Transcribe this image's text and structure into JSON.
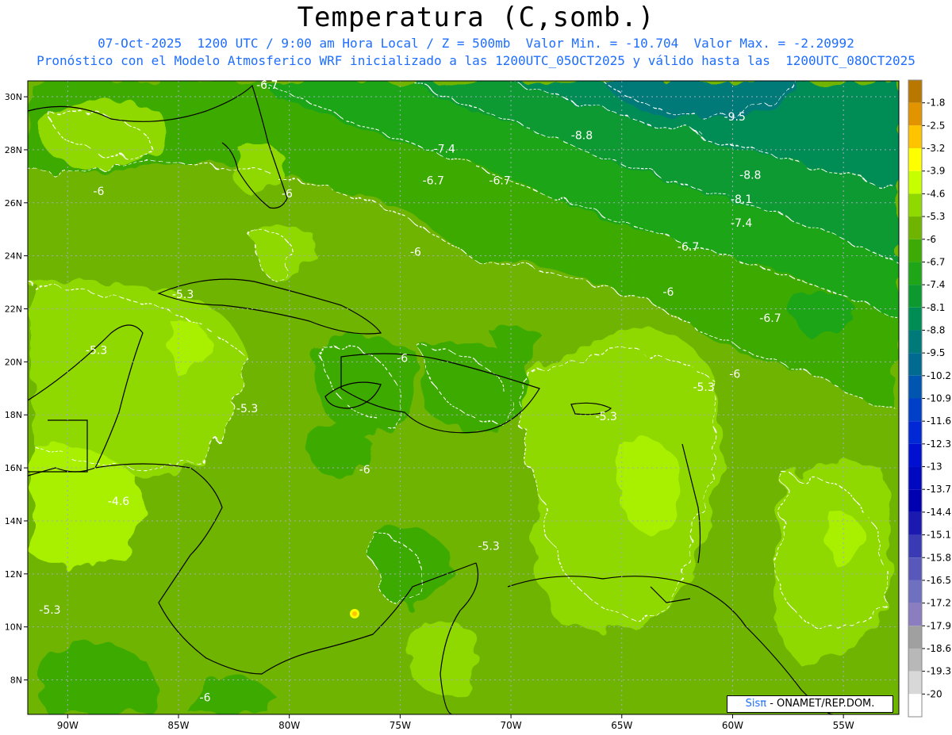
{
  "title": "Temperatura (C,somb.)",
  "subtitle_line1": "07-Oct-2025  1200 UTC / 9:00 am Hora Local / Z = 500mb  Valor Min. = -10.704  Valor Max. = -2.20992",
  "subtitle_line2": "Pronóstico con el Modelo Atmosferico WRF inicializado a las 1200UTC_05OCT2025 y válido hasta las  1200UTC_08OCT2025",
  "credit": {
    "logo": "Sisπ",
    "text": " - ONAMET/REP.DOM."
  },
  "chart_data": {
    "type": "heatmap",
    "x_ticks": [
      {
        "lon": -90,
        "label": "90W"
      },
      {
        "lon": -85,
        "label": "85W"
      },
      {
        "lon": -80,
        "label": "80W"
      },
      {
        "lon": -75,
        "label": "75W"
      },
      {
        "lon": -70,
        "label": "70W"
      },
      {
        "lon": -65,
        "label": "65W"
      },
      {
        "lon": -60,
        "label": "60W"
      },
      {
        "lon": -55,
        "label": "55W"
      }
    ],
    "y_ticks": [
      {
        "lat": 30,
        "label": "30N"
      },
      {
        "lat": 28,
        "label": "28N"
      },
      {
        "lat": 26,
        "label": "26N"
      },
      {
        "lat": 24,
        "label": "24N"
      },
      {
        "lat": 22,
        "label": "22N"
      },
      {
        "lat": 20,
        "label": "20N"
      },
      {
        "lat": 18,
        "label": "18N"
      },
      {
        "lat": 16,
        "label": "16N"
      },
      {
        "lat": 14,
        "label": "14N"
      },
      {
        "lat": 12,
        "label": "12N"
      },
      {
        "lat": 10,
        "label": "10N"
      },
      {
        "lat": 8,
        "label": "8N"
      }
    ],
    "xlim": [
      -91.8,
      -52.5
    ],
    "ylim": [
      6.7,
      30.6
    ],
    "grid": true,
    "colorbar": [
      {
        "label": "-1.8",
        "color": "#b87800"
      },
      {
        "label": "-2.5",
        "color": "#e29400"
      },
      {
        "label": "-3.2",
        "color": "#ffc400"
      },
      {
        "label": "-3.9",
        "color": "#ffff00"
      },
      {
        "label": "-4.6",
        "color": "#c8ff00"
      },
      {
        "label": "-5.3",
        "color": "#8fd800"
      },
      {
        "label": "-6",
        "color": "#6eb400"
      },
      {
        "label": "-6.7",
        "color": "#3eaa06"
      },
      {
        "label": "-7.4",
        "color": "#1fa518"
      },
      {
        "label": "-8.1",
        "color": "#0c9a30"
      },
      {
        "label": "-8.8",
        "color": "#008c55"
      },
      {
        "label": "-9.5",
        "color": "#007a78"
      },
      {
        "label": "-10.2",
        "color": "#006a90"
      },
      {
        "label": "-10.9",
        "color": "#0055b0"
      },
      {
        "label": "-11.6",
        "color": "#0040c8"
      },
      {
        "label": "-12.3",
        "color": "#0028d4"
      },
      {
        "label": "-13",
        "color": "#0010d0"
      },
      {
        "label": "-13.7",
        "color": "#0008c0"
      },
      {
        "label": "-14.4",
        "color": "#0000b0"
      },
      {
        "label": "-15.1",
        "color": "#1a1ab0"
      },
      {
        "label": "-15.8",
        "color": "#3a3ab4"
      },
      {
        "label": "-16.5",
        "color": "#5858ba"
      },
      {
        "label": "-17.2",
        "color": "#7070c0"
      },
      {
        "label": "-17.9",
        "color": "#8c7cc0"
      },
      {
        "label": "-18.6",
        "color": "#a0a0a0"
      },
      {
        "label": "-19.3",
        "color": "#b8b8b8"
      },
      {
        "label": "-20",
        "color": "#d8d8d8"
      },
      {
        "label": "",
        "color": "#ffffff"
      }
    ],
    "contour_labels": [
      {
        "text": "-6.7",
        "lon": -81.0,
        "lat": 30.3
      },
      {
        "text": "-9.5",
        "lon": -59.9,
        "lat": 29.1
      },
      {
        "text": "-8.8",
        "lon": -66.8,
        "lat": 28.4
      },
      {
        "text": "-7.4",
        "lon": -73.0,
        "lat": 27.9
      },
      {
        "text": "-8.8",
        "lon": -59.2,
        "lat": 26.9
      },
      {
        "text": "-6.7",
        "lon": -73.5,
        "lat": 26.7
      },
      {
        "text": "-6.7",
        "lon": -70.5,
        "lat": 26.7
      },
      {
        "text": "-8.1",
        "lon": -59.6,
        "lat": 26.0
      },
      {
        "text": "-6",
        "lon": -88.6,
        "lat": 26.3
      },
      {
        "text": "-6",
        "lon": -80.1,
        "lat": 26.2
      },
      {
        "text": "-7.4",
        "lon": -59.6,
        "lat": 25.1
      },
      {
        "text": "-6.7",
        "lon": -62.0,
        "lat": 24.2
      },
      {
        "text": "-6",
        "lon": -74.3,
        "lat": 24.0
      },
      {
        "text": "-5.3",
        "lon": -84.8,
        "lat": 22.4
      },
      {
        "text": "-6",
        "lon": -62.9,
        "lat": 22.5
      },
      {
        "text": "-6.7",
        "lon": -58.3,
        "lat": 21.5
      },
      {
        "text": "-5.3",
        "lon": -88.7,
        "lat": 20.3
      },
      {
        "text": "-6",
        "lon": -74.9,
        "lat": 20.0
      },
      {
        "text": "-6",
        "lon": -59.9,
        "lat": 19.4
      },
      {
        "text": "-5.3",
        "lon": -61.3,
        "lat": 18.9
      },
      {
        "text": "-5.3",
        "lon": -81.9,
        "lat": 18.1
      },
      {
        "text": "-5.3",
        "lon": -65.7,
        "lat": 17.8
      },
      {
        "text": "-6",
        "lon": -76.6,
        "lat": 15.8
      },
      {
        "text": "-4.6",
        "lon": -87.7,
        "lat": 14.6
      },
      {
        "text": "-5.3",
        "lon": -71.0,
        "lat": 12.9
      },
      {
        "text": "-5.3",
        "lon": -90.8,
        "lat": 10.5
      },
      {
        "text": "-6",
        "lon": -83.8,
        "lat": 7.2
      }
    ]
  }
}
